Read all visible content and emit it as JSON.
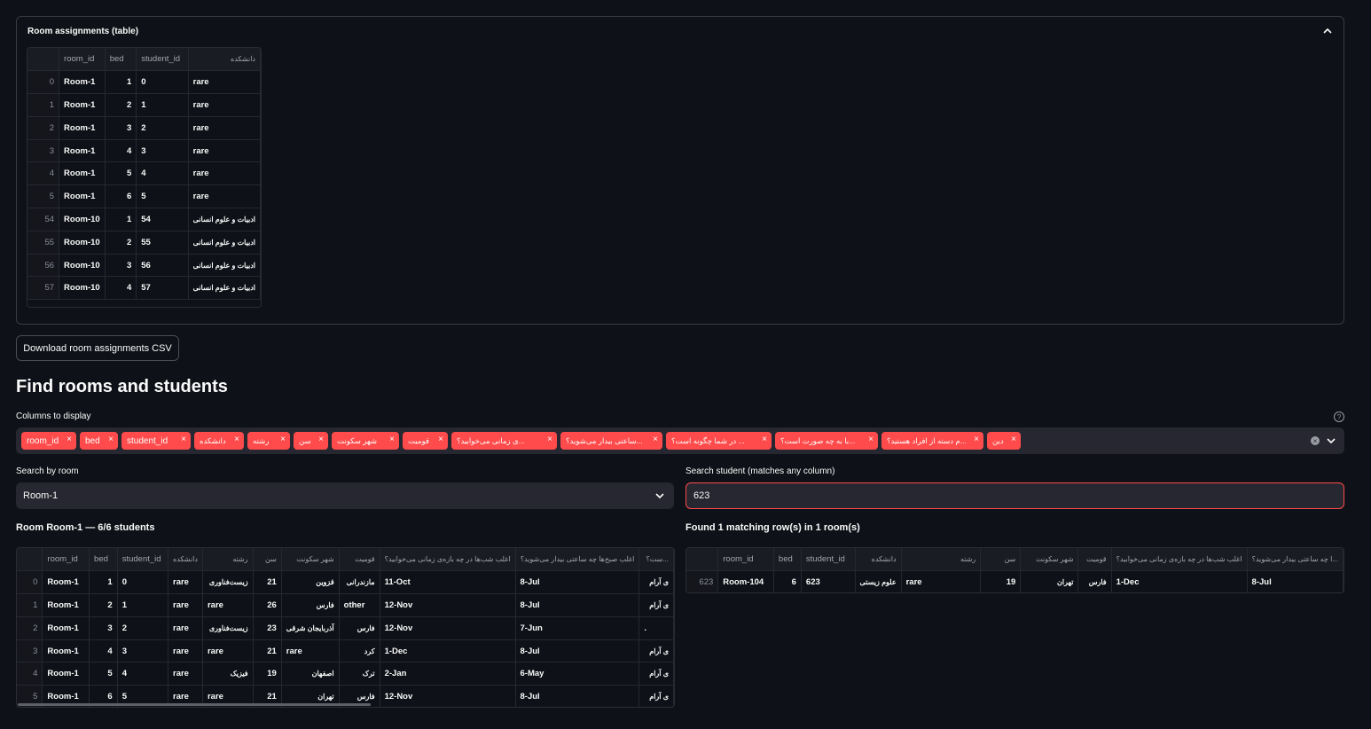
{
  "assignments": {
    "expander_title": "Room assignments (table)",
    "columns": [
      "",
      "room_id",
      "bed",
      "student_id",
      "دانشکده"
    ],
    "rows": [
      [
        "0",
        "Room-1",
        "1",
        "0",
        "rare"
      ],
      [
        "1",
        "Room-1",
        "2",
        "1",
        "rare"
      ],
      [
        "2",
        "Room-1",
        "3",
        "2",
        "rare"
      ],
      [
        "3",
        "Room-1",
        "4",
        "3",
        "rare"
      ],
      [
        "4",
        "Room-1",
        "5",
        "4",
        "rare"
      ],
      [
        "5",
        "Room-1",
        "6",
        "5",
        "rare"
      ],
      [
        "54",
        "Room-10",
        "1",
        "54",
        "ادبیات و علوم انسانی"
      ],
      [
        "55",
        "Room-10",
        "2",
        "55",
        "ادبیات و علوم انسانی"
      ],
      [
        "56",
        "Room-10",
        "3",
        "56",
        "ادبیات و علوم انسانی"
      ],
      [
        "57",
        "Room-10",
        "4",
        "57",
        "ادبیات و علوم انسانی"
      ]
    ]
  },
  "download_button": "Download room assignments CSV",
  "find_heading": "Find rooms and students",
  "columns_label": "Columns to display",
  "column_chips": [
    "room_id",
    "bed",
    "student_id",
    "دانشکده",
    "رشته",
    "سن",
    "شهر سکونت",
    "قومیت",
    "...ی زمانی می‌خوابید؟",
    "...ساعتی بیدار می‌شوید؟",
    "... در شما چگونه است؟",
    "...با به چه صورت است؟",
    "...م دسته از افراد هستید؟",
    "دین"
  ],
  "search_room": {
    "label": "Search by room",
    "value": "Room-1"
  },
  "search_student": {
    "label": "Search student (matches any column)",
    "value": "623"
  },
  "room_result": {
    "title": "Room Room-1 — 6/6 students",
    "columns": [
      "",
      "room_id",
      "bed",
      "student_id",
      "دانشکده",
      "رشته",
      "سن",
      "شهر سکونت",
      "قومیت",
      "اغلب شب‌ها در چه بازه‌ی زمانی می‌خوابید؟",
      "اغلب صبح‌ها چه ساعتی بیدار می‌شوید؟",
      "...ست؟"
    ],
    "rows": [
      [
        "0",
        "Room-1",
        "1",
        "0",
        "rare",
        "زیست‌فناوری",
        "21",
        "قزوین",
        "مازندرانی",
        "11-Oct",
        "8-Jul",
        "ی آرام"
      ],
      [
        "1",
        "Room-1",
        "2",
        "1",
        "rare",
        "rare",
        "26",
        "فارس",
        "other",
        "12-Nov",
        "8-Jul",
        "ی آرام"
      ],
      [
        "2",
        "Room-1",
        "3",
        "2",
        "rare",
        "زیست‌فناوری",
        "23",
        "آذربایجان شرقی",
        "فارس",
        "12-Nov",
        "7-Jun",
        "."
      ],
      [
        "3",
        "Room-1",
        "4",
        "3",
        "rare",
        "rare",
        "21",
        "rare",
        "کرد",
        "1-Dec",
        "8-Jul",
        "ی آرام"
      ],
      [
        "4",
        "Room-1",
        "5",
        "4",
        "rare",
        "فیزیک",
        "19",
        "اصفهان",
        "ترک",
        "2-Jan",
        "6-May",
        "ی آرام"
      ],
      [
        "5",
        "Room-1",
        "6",
        "5",
        "rare",
        "rare",
        "21",
        "تهران",
        "فارس",
        "12-Nov",
        "8-Jul",
        "ی آرام"
      ]
    ]
  },
  "student_result": {
    "title": "Found 1 matching row(s) in 1 room(s)",
    "columns": [
      "",
      "room_id",
      "bed",
      "student_id",
      "دانشکده",
      "رشته",
      "سن",
      "شهر سکونت",
      "قومیت",
      "اغلب شب‌ها در چه بازه‌ی زمانی می‌خوابید؟",
      "...ا چه ساعتی بیدار می‌شوید؟"
    ],
    "rows": [
      [
        "623",
        "Room-104",
        "6",
        "623",
        "علوم زیستی",
        "rare",
        "19",
        "تهران",
        "فارس",
        "1-Dec",
        "8-Jul"
      ]
    ]
  },
  "accent_color": "#ff4b4b"
}
